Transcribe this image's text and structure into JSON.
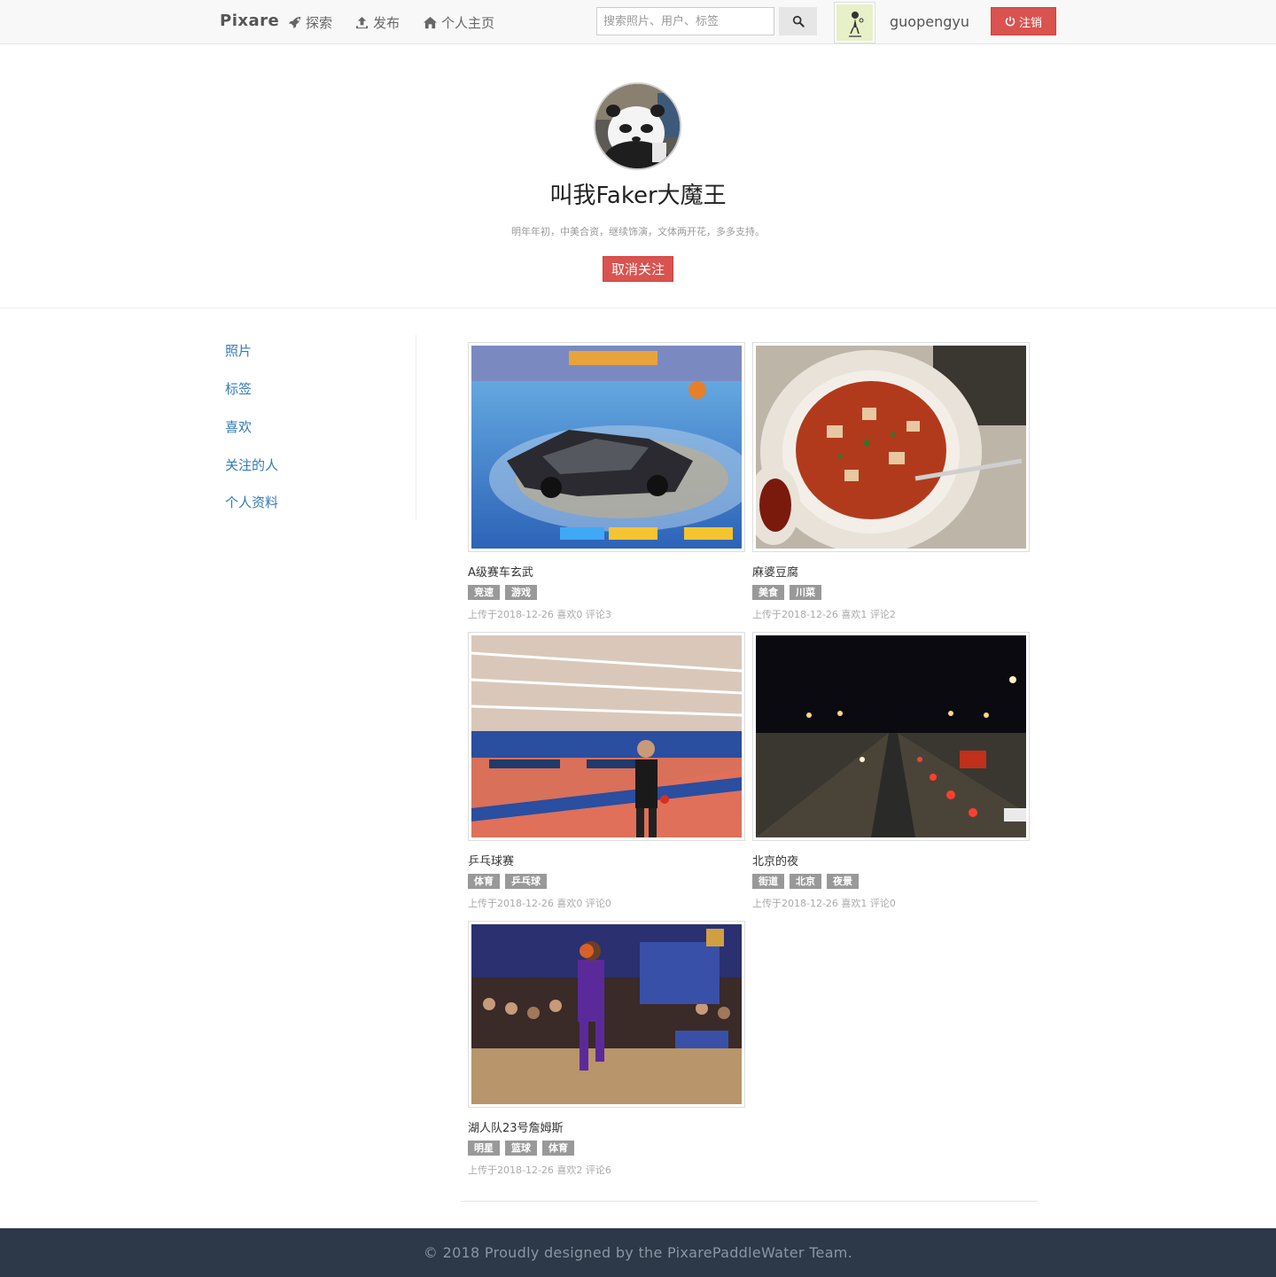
{
  "navbar": {
    "brand": "Pixare",
    "links": [
      {
        "label": "探索",
        "icon": "rocket-icon"
      },
      {
        "label": "发布",
        "icon": "upload-icon"
      },
      {
        "label": "个人主页",
        "icon": "home-icon"
      }
    ],
    "search_placeholder": "搜索照片、用户、标签",
    "username": "guopengyu",
    "logout_label": "注销"
  },
  "profile": {
    "name": "叫我Faker大魔王",
    "bio": "明年年初，中美合资，继续饰演，文体两开花，多多支持。",
    "unfollow_label": "取消关注"
  },
  "sidebar": {
    "items": [
      "照片",
      "标签",
      "喜欢",
      "关注的人",
      "个人资料"
    ]
  },
  "photos": [
    {
      "title": "A级赛车玄武",
      "tags": [
        "竞速",
        "游戏"
      ],
      "meta": "上传于2018-12-26 喜欢0 评论3"
    },
    {
      "title": "麻婆豆腐",
      "tags": [
        "美食",
        "川菜"
      ],
      "meta": "上传于2018-12-26 喜欢1 评论2"
    },
    {
      "title": "乒乓球赛",
      "tags": [
        "体育",
        "乒乓球"
      ],
      "meta": "上传于2018-12-26 喜欢0 评论0"
    },
    {
      "title": "北京的夜",
      "tags": [
        "街道",
        "北京",
        "夜景"
      ],
      "meta": "上传于2018-12-26 喜欢1 评论0"
    },
    {
      "title": "湖人队23号詹姆斯",
      "tags": [
        "明星",
        "篮球",
        "体育"
      ],
      "meta": "上传于2018-12-26 喜欢2 评论6"
    }
  ],
  "footer": {
    "text": "© 2018 Proudly designed by the PixarePaddleWater Team."
  }
}
